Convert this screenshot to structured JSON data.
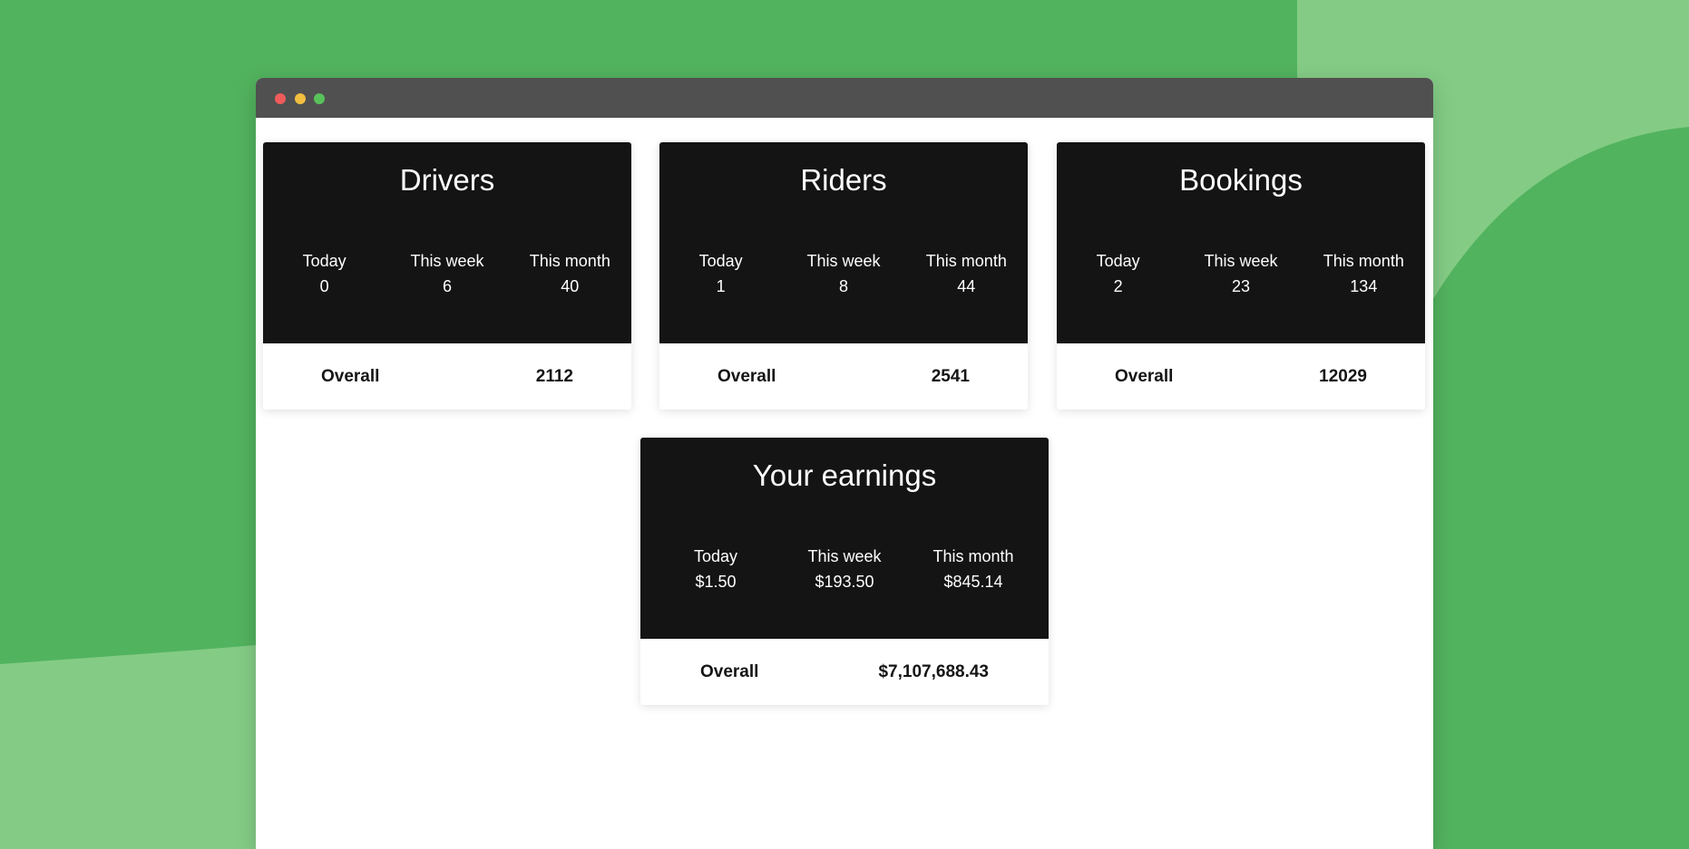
{
  "colors": {
    "background": "#52b35e",
    "background_light": "#84cc86",
    "titlebar": "#505050",
    "card_header": "#141414",
    "card_body": "#ffffff",
    "dot_red": "#ef5b5b",
    "dot_yellow": "#f1be3f",
    "dot_green": "#58c25a"
  },
  "cards": {
    "drivers": {
      "title": "Drivers",
      "today_label": "Today",
      "today_value": "0",
      "week_label": "This week",
      "week_value": "6",
      "month_label": "This month",
      "month_value": "40",
      "overall_label": "Overall",
      "overall_value": "2112"
    },
    "riders": {
      "title": "Riders",
      "today_label": "Today",
      "today_value": "1",
      "week_label": "This week",
      "week_value": "8",
      "month_label": "This month",
      "month_value": "44",
      "overall_label": "Overall",
      "overall_value": "2541"
    },
    "bookings": {
      "title": "Bookings",
      "today_label": "Today",
      "today_value": "2",
      "week_label": "This week",
      "week_value": "23",
      "month_label": "This month",
      "month_value": "134",
      "overall_label": "Overall",
      "overall_value": "12029"
    },
    "earnings": {
      "title": "Your earnings",
      "today_label": "Today",
      "today_value": "$1.50",
      "week_label": "This week",
      "week_value": "$193.50",
      "month_label": "This month",
      "month_value": "$845.14",
      "overall_label": "Overall",
      "overall_value": "$7,107,688.43"
    }
  }
}
